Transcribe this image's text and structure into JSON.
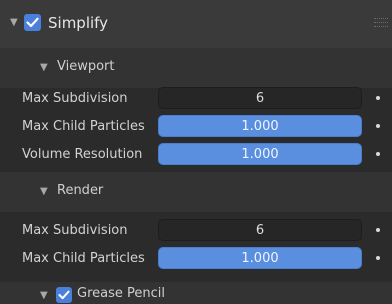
{
  "panel": {
    "title": "Simplify",
    "enabled": true
  },
  "viewport": {
    "title": "Viewport",
    "rows": [
      {
        "label": "Max Subdivision",
        "value": "6",
        "kind": "int"
      },
      {
        "label": "Max Child Particles",
        "value": "1.000",
        "kind": "slider",
        "fraction": 1.0
      },
      {
        "label": "Volume Resolution",
        "value": "1.000",
        "kind": "slider",
        "fraction": 1.0
      }
    ]
  },
  "render": {
    "title": "Render",
    "rows": [
      {
        "label": "Max Subdivision",
        "value": "6",
        "kind": "int"
      },
      {
        "label": "Max Child Particles",
        "value": "1.000",
        "kind": "slider",
        "fraction": 1.0
      }
    ]
  },
  "grease_pencil": {
    "title": "Grease Pencil",
    "enabled": true
  },
  "colors": {
    "accent": "#5a8fe0",
    "checkbox": "#4a7fdc",
    "background": "#2b2b2b"
  }
}
